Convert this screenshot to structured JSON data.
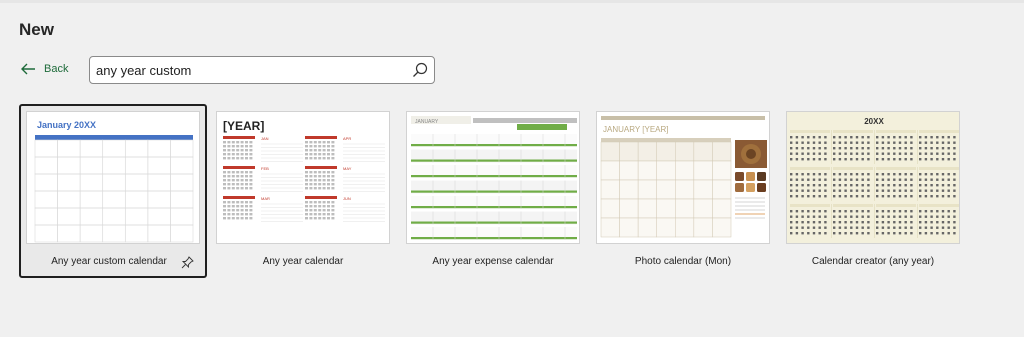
{
  "page": {
    "title": "New"
  },
  "nav": {
    "back_label": "Back",
    "back_icon": "arrow-left-icon"
  },
  "search": {
    "value": "any year custom",
    "icon": "search-icon"
  },
  "templates": [
    {
      "label": "Any year custom calendar",
      "selected": true,
      "pin_icon": "pin-icon",
      "thumb": {
        "heading": "January 20XX"
      }
    },
    {
      "label": "Any year calendar",
      "thumb": {
        "heading": "[YEAR]",
        "months": [
          "JAN",
          "APR",
          "FEB",
          "MAY",
          "MAR",
          "JUN"
        ]
      }
    },
    {
      "label": "Any year expense calendar",
      "thumb": {
        "heading": "JANUARY"
      }
    },
    {
      "label": "Photo calendar (Mon)",
      "thumb": {
        "heading": "JANUARY [YEAR]"
      }
    },
    {
      "label": "Calendar creator (any year)",
      "thumb": {
        "heading": "20XX"
      }
    }
  ],
  "colors": {
    "accent_green": "#1e6b3a",
    "calendar_blue": "#4472c4",
    "calendar_red": "#c0392b",
    "expense_green": "#70ad47",
    "photo_tan": "#c8bfa8",
    "creator_cream": "#f3f0dc"
  }
}
